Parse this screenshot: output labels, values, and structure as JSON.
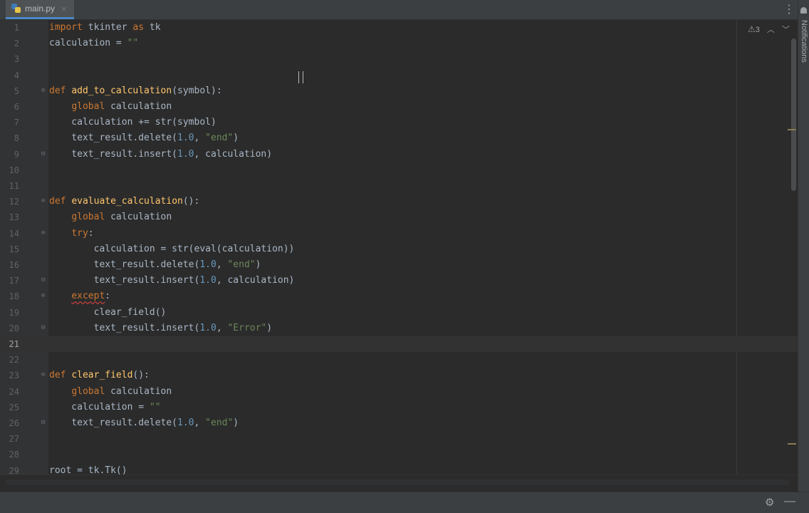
{
  "tab": {
    "filename": "main.py",
    "icon": "python-file-icon"
  },
  "inspections": {
    "warnings": "3"
  },
  "sidebar": {
    "notifications_label": "Notifications"
  },
  "lines": [
    {
      "n": "1"
    },
    {
      "n": "2"
    },
    {
      "n": "3"
    },
    {
      "n": "4"
    },
    {
      "n": "5"
    },
    {
      "n": "6"
    },
    {
      "n": "7"
    },
    {
      "n": "8"
    },
    {
      "n": "9"
    },
    {
      "n": "10"
    },
    {
      "n": "11"
    },
    {
      "n": "12"
    },
    {
      "n": "13"
    },
    {
      "n": "14"
    },
    {
      "n": "15"
    },
    {
      "n": "16"
    },
    {
      "n": "17"
    },
    {
      "n": "18"
    },
    {
      "n": "19"
    },
    {
      "n": "20"
    },
    {
      "n": "21"
    },
    {
      "n": "22"
    },
    {
      "n": "23"
    },
    {
      "n": "24"
    },
    {
      "n": "25"
    },
    {
      "n": "26"
    },
    {
      "n": "27"
    },
    {
      "n": "28"
    },
    {
      "n": "29"
    }
  ],
  "code": [
    [
      [
        "kw",
        "import"
      ],
      [
        "t",
        " tkinter "
      ],
      [
        "kw",
        "as"
      ],
      [
        "t",
        " tk"
      ]
    ],
    [
      [
        "t",
        "calculation = "
      ],
      [
        "str",
        "\"\""
      ]
    ],
    [],
    [],
    [
      [
        "kw",
        "def "
      ],
      [
        "fn",
        "add_to_calculation"
      ],
      [
        "t",
        "(symbol):"
      ]
    ],
    [
      [
        "t",
        "    "
      ],
      [
        "kw",
        "global"
      ],
      [
        "t",
        " calculation"
      ]
    ],
    [
      [
        "t",
        "    calculation += str(symbol)"
      ]
    ],
    [
      [
        "t",
        "    text_result.delete("
      ],
      [
        "num",
        "1.0"
      ],
      [
        "t",
        ", "
      ],
      [
        "str",
        "\"end\""
      ],
      [
        "t",
        ")"
      ]
    ],
    [
      [
        "t",
        "    text_result.insert("
      ],
      [
        "num",
        "1.0"
      ],
      [
        "t",
        ", calculation)"
      ]
    ],
    [],
    [],
    [
      [
        "kw",
        "def "
      ],
      [
        "fn",
        "evaluate_calculation"
      ],
      [
        "t",
        "():"
      ]
    ],
    [
      [
        "t",
        "    "
      ],
      [
        "kw",
        "global"
      ],
      [
        "t",
        " calculation"
      ]
    ],
    [
      [
        "t",
        "    "
      ],
      [
        "kw",
        "try"
      ],
      [
        "t",
        ":"
      ]
    ],
    [
      [
        "t",
        "        calculation = str(eval(calculation))"
      ]
    ],
    [
      [
        "t",
        "        text_result.delete("
      ],
      [
        "num",
        "1.0"
      ],
      [
        "t",
        ", "
      ],
      [
        "str",
        "\"end\""
      ],
      [
        "t",
        ")"
      ]
    ],
    [
      [
        "t",
        "        text_result.insert("
      ],
      [
        "num",
        "1.0"
      ],
      [
        "t",
        ", calculation)"
      ]
    ],
    [
      [
        "t",
        "    "
      ],
      [
        "kwu",
        "except"
      ],
      [
        "t",
        ":"
      ]
    ],
    [
      [
        "t",
        "        clear_field()"
      ]
    ],
    [
      [
        "t",
        "        text_result.insert("
      ],
      [
        "num",
        "1.0"
      ],
      [
        "t",
        ", "
      ],
      [
        "str",
        "\"Error\""
      ],
      [
        "t",
        ")"
      ]
    ],
    [],
    [],
    [
      [
        "kw",
        "def "
      ],
      [
        "fn",
        "clear_field"
      ],
      [
        "t",
        "():"
      ]
    ],
    [
      [
        "t",
        "    "
      ],
      [
        "kw",
        "global"
      ],
      [
        "t",
        " calculation"
      ]
    ],
    [
      [
        "t",
        "    calculation = "
      ],
      [
        "str",
        "\"\""
      ]
    ],
    [
      [
        "t",
        "    text_result.delete("
      ],
      [
        "num",
        "1.0"
      ],
      [
        "t",
        ", "
      ],
      [
        "str",
        "\"end\""
      ],
      [
        "t",
        ")"
      ]
    ],
    [],
    [],
    [
      [
        "t",
        "root = tk.Tk()"
      ]
    ]
  ],
  "folds": {
    "5": "open",
    "9": "close",
    "12": "open",
    "14": "open",
    "17": "close",
    "18": "open",
    "20": "close",
    "23": "open",
    "26": "close"
  },
  "current_line": 21
}
